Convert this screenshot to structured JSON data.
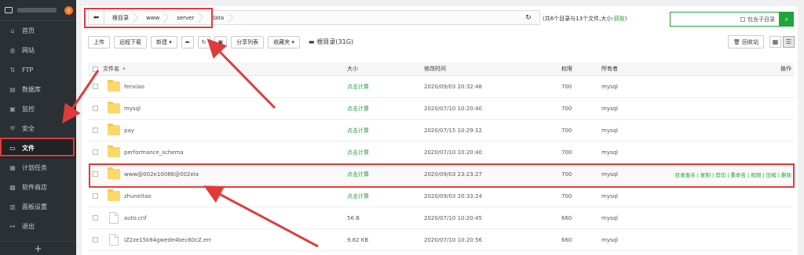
{
  "sidebar": {
    "badge": "0",
    "items": [
      {
        "label": "首页",
        "icon": "home-icon",
        "glyph": "⌂"
      },
      {
        "label": "网站",
        "icon": "globe-icon",
        "glyph": "◍"
      },
      {
        "label": "FTP",
        "icon": "ftp-icon",
        "glyph": "⇅"
      },
      {
        "label": "数据库",
        "icon": "database-icon",
        "glyph": "▤"
      },
      {
        "label": "监控",
        "icon": "monitor-icon",
        "glyph": "▣"
      },
      {
        "label": "安全",
        "icon": "shield-icon",
        "glyph": "⛨"
      },
      {
        "label": "文件",
        "icon": "folder-icon",
        "glyph": "▭"
      },
      {
        "label": "计划任务",
        "icon": "calendar-icon",
        "glyph": "▦"
      },
      {
        "label": "软件商店",
        "icon": "store-icon",
        "glyph": "▩"
      },
      {
        "label": "面板设置",
        "icon": "settings-icon",
        "glyph": "▥"
      },
      {
        "label": "退出",
        "icon": "logout-icon",
        "glyph": "↦"
      }
    ],
    "add_label": "+"
  },
  "path": {
    "crumbs": [
      "根目录",
      "www",
      "server",
      "data"
    ],
    "summary_prefix": "(共6个目录与13个文件,大小:",
    "summary_link": "获取",
    "summary_suffix": ")"
  },
  "search": {
    "include_subdir": "包含子目录"
  },
  "toolbar": {
    "upload": "上传",
    "remote_download": "远程下载",
    "new": "新建",
    "share_list": "分享列表",
    "favorites": "收藏夹",
    "disk": "根目录(31G)",
    "recycle": "回收站"
  },
  "table": {
    "headers": {
      "name": "文件名",
      "size": "大小",
      "time": "修改时间",
      "perm": "权限",
      "owner": "所有者",
      "ops": "操作"
    },
    "rows": [
      {
        "name": "fenxiao",
        "type": "folder",
        "size": "点击计算",
        "time": "2020/09/03 20:32:48",
        "perm": "700",
        "owner": "mysql"
      },
      {
        "name": "mysql",
        "type": "folder",
        "size": "点击计算",
        "time": "2020/07/10 10:20:40",
        "perm": "700",
        "owner": "mysql"
      },
      {
        "name": "pay",
        "type": "folder",
        "size": "点击计算",
        "time": "2020/07/15 10:29:12",
        "perm": "700",
        "owner": "mysql"
      },
      {
        "name": "performance_schema",
        "type": "folder",
        "size": "点击计算",
        "time": "2020/07/10 10:20:40",
        "perm": "700",
        "owner": "mysql"
      },
      {
        "name": "www@002e10086@002ela",
        "type": "folder",
        "size": "点击计算",
        "time": "2020/09/03 23:23:27",
        "perm": "700",
        "owner": "mysql",
        "ops": "目录查杀 | 复制 | 剪切 | 重命名 | 权限 | 压缩 | 删除"
      },
      {
        "name": "zhuneitao",
        "type": "folder",
        "size": "点击计算",
        "time": "2020/09/03 20:33:24",
        "perm": "700",
        "owner": "mysql"
      },
      {
        "name": "auto.cnf",
        "type": "file",
        "size": "56 B",
        "time": "2020/07/10 10:20:45",
        "perm": "660",
        "owner": "mysql"
      },
      {
        "name": "iZ2ze15k84gwede4bec60cZ.err",
        "type": "file",
        "size": "9.82 KB",
        "time": "2020/07/10 10:20:56",
        "perm": "660",
        "owner": "mysql"
      }
    ]
  },
  "colors": {
    "accent": "#20a53a",
    "annotation": "#e03b3b",
    "sidebar_bg": "#2b3034"
  }
}
